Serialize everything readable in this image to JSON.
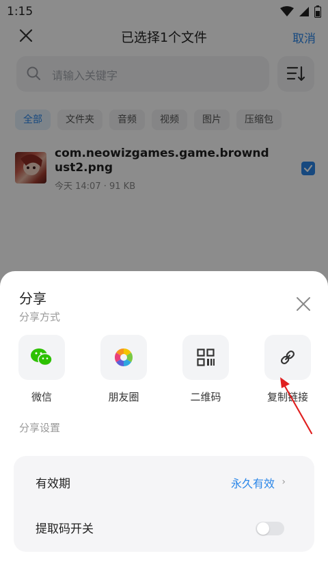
{
  "status_bar": {
    "time": "1:15"
  },
  "header": {
    "title": "已选择1个文件",
    "cancel_label": "取消"
  },
  "search": {
    "placeholder": "请输入关键字"
  },
  "filters": [
    "全部",
    "文件夹",
    "音频",
    "视频",
    "图片",
    "压缩包"
  ],
  "active_filter": "全部",
  "file": {
    "name": "com.neowizgames.game.browndust2.png",
    "meta": "今天 14:07 · 91 KB",
    "selected": true
  },
  "share_sheet": {
    "title": "分享",
    "subtitle": "分享方式",
    "options": [
      {
        "label": "微信",
        "icon": "wechat-icon"
      },
      {
        "label": "朋友圈",
        "icon": "moments-icon"
      },
      {
        "label": "二维码",
        "icon": "qr-code-icon"
      },
      {
        "label": "复制链接",
        "icon": "link-icon"
      }
    ],
    "settings_label": "分享设置",
    "settings": {
      "validity_label": "有效期",
      "validity_value": "永久有效",
      "code_switch_label": "提取码开关",
      "code_switch_on": false
    }
  },
  "colors": {
    "accent": "#2a86e8",
    "wechat_green": "#2dc100",
    "annotation_red": "#e02020",
    "overlay": "rgba(0,0,0,0.45)"
  }
}
